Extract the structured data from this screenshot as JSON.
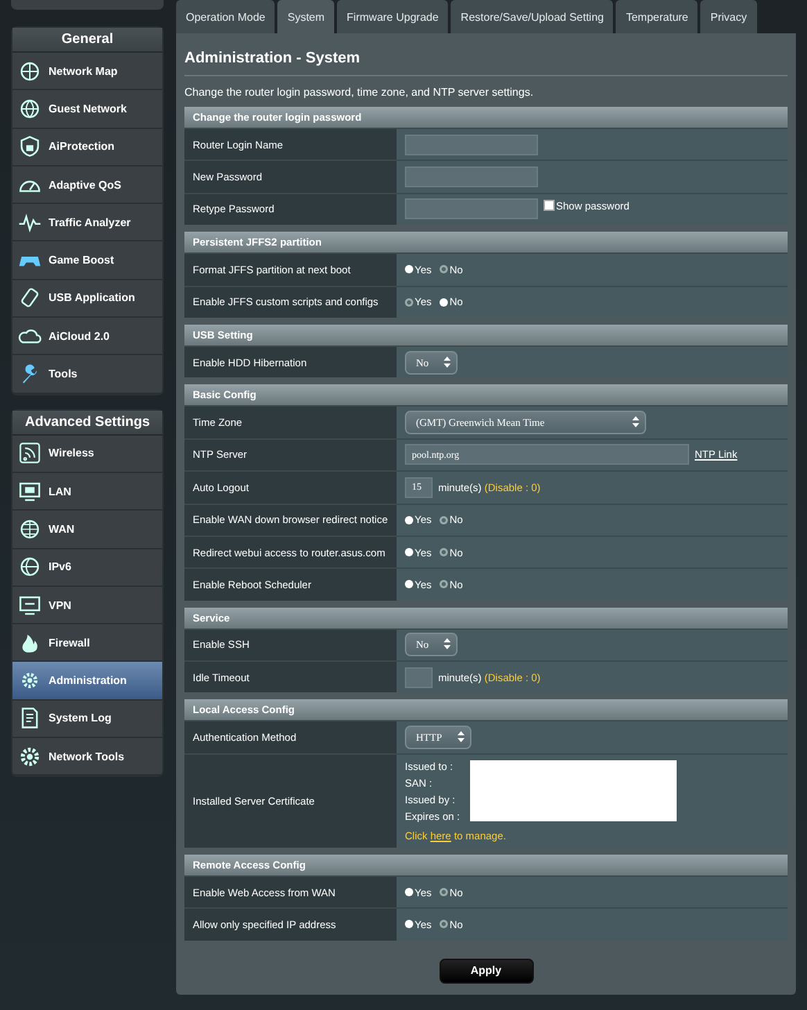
{
  "sidebar": [
    {
      "title": "General",
      "items": [
        {
          "label": "Network Map",
          "selected": false
        },
        {
          "label": "Guest Network",
          "selected": false
        },
        {
          "label": "AiProtection",
          "selected": false
        },
        {
          "label": "Adaptive QoS",
          "selected": false
        },
        {
          "label": "Traffic Analyzer",
          "selected": false
        },
        {
          "label": "Game Boost",
          "selected": false
        },
        {
          "label": "USB Application",
          "selected": false
        },
        {
          "label": "AiCloud 2.0",
          "selected": false
        },
        {
          "label": "Tools",
          "selected": false
        }
      ]
    },
    {
      "title": "Advanced Settings",
      "items": [
        {
          "label": "Wireless",
          "selected": false
        },
        {
          "label": "LAN",
          "selected": false
        },
        {
          "label": "WAN",
          "selected": false
        },
        {
          "label": "IPv6",
          "selected": false
        },
        {
          "label": "VPN",
          "selected": false
        },
        {
          "label": "Firewall",
          "selected": false
        },
        {
          "label": "Administration",
          "selected": true
        },
        {
          "label": "System Log",
          "selected": false
        },
        {
          "label": "Network Tools",
          "selected": false
        }
      ]
    }
  ],
  "tabs": [
    {
      "label": "Operation Mode",
      "selected": false
    },
    {
      "label": "System",
      "selected": true
    },
    {
      "label": "Firmware Upgrade",
      "selected": false
    },
    {
      "label": "Restore/Save/Upload Setting",
      "selected": false
    },
    {
      "label": "Temperature",
      "selected": false
    },
    {
      "label": "Privacy",
      "selected": false
    }
  ],
  "title": "Administration - System",
  "description": "Change the router login password, time zone, and NTP server settings.",
  "sections": [
    {
      "title": "Change the router login password",
      "rows": [
        {
          "kind": "input",
          "label": "Router Login Name"
        },
        {
          "kind": "input",
          "label": "New Password"
        },
        {
          "kind": "password",
          "label": "Retype Password",
          "toggle": {
            "label": "Show password",
            "checked": false
          }
        }
      ]
    },
    {
      "title": "Persistent JFFS2 partition",
      "rows": [
        {
          "kind": "radio",
          "label": "Format JFFS partition at next boot",
          "options": [
            {
              "label": "Yes",
              "selected": false
            },
            {
              "label": "No",
              "selected": true
            }
          ]
        },
        {
          "kind": "radio",
          "label": "Enable JFFS custom scripts and configs",
          "options": [
            {
              "label": "Yes",
              "selected": true
            },
            {
              "label": "No",
              "selected": false
            }
          ]
        }
      ]
    },
    {
      "title": "USB Setting",
      "rows": [
        {
          "kind": "select",
          "label": "Enable HDD Hibernation",
          "value": "No"
        }
      ]
    },
    {
      "title": "Basic Config",
      "rows": [
        {
          "kind": "select",
          "label": "Time Zone",
          "value": "(GMT) Greenwich Mean Time"
        },
        {
          "kind": "link-input",
          "label": "NTP Server",
          "value": "pool.ntp.org",
          "link": "NTP Link"
        },
        {
          "kind": "number",
          "label": "Auto Logout",
          "value": "15",
          "unit": "minute(s)",
          "hint": "(Disable : 0)"
        },
        {
          "kind": "radio",
          "label": "Enable WAN down browser redirect notice",
          "options": [
            {
              "label": "Yes",
              "selected": false
            },
            {
              "label": "No",
              "selected": true
            }
          ]
        },
        {
          "kind": "radio",
          "label": "Redirect webui access to router.asus.com",
          "options": [
            {
              "label": "Yes",
              "selected": false
            },
            {
              "label": "No",
              "selected": true
            }
          ]
        },
        {
          "kind": "radio",
          "label": "Enable Reboot Scheduler",
          "options": [
            {
              "label": "Yes",
              "selected": false
            },
            {
              "label": "No",
              "selected": true
            }
          ]
        }
      ]
    },
    {
      "title": "Service",
      "rows": [
        {
          "kind": "select",
          "label": "Enable SSH",
          "value": "No"
        },
        {
          "kind": "number",
          "label": "Idle Timeout",
          "unit": "minute(s)",
          "hint": "(Disable : 0)"
        }
      ]
    },
    {
      "title": "Local Access Config",
      "rows": [
        {
          "kind": "select",
          "label": "Authentication Method",
          "value": "HTTP"
        },
        {
          "kind": "certificate",
          "label": "Installed Server Certificate",
          "fields": [
            "Issued to :",
            "SAN :",
            "Issued by :",
            "Expires on :"
          ],
          "note_before": "Click ",
          "note_link": "here",
          "note_after": " to manage."
        }
      ]
    },
    {
      "title": "Remote Access Config",
      "rows": [
        {
          "kind": "radio",
          "label": "Enable Web Access from WAN",
          "options": [
            {
              "label": "Yes",
              "selected": false
            },
            {
              "label": "No",
              "selected": true
            }
          ]
        },
        {
          "kind": "radio",
          "label": "Allow only specified IP address",
          "options": [
            {
              "label": "Yes",
              "selected": false
            },
            {
              "label": "No",
              "selected": true
            }
          ]
        }
      ]
    }
  ],
  "apply": "Apply"
}
